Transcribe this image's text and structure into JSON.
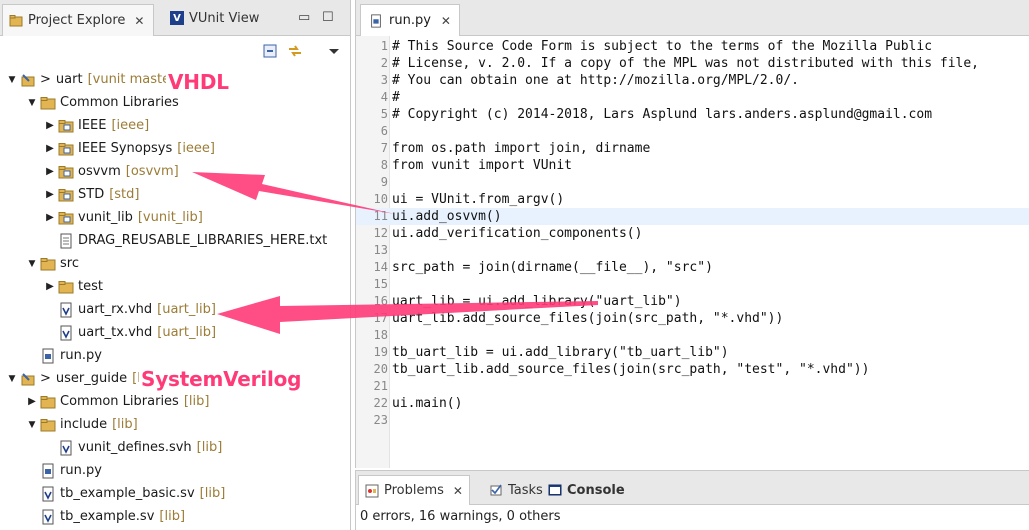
{
  "left_pane": {
    "tabs": [
      {
        "label": "Project Explore"
      },
      {
        "label": "VUnit View"
      }
    ],
    "tab_close": "✕",
    "minimize": "▭",
    "maximize": "☐",
    "tree": [
      {
        "label": "uart",
        "decoration": "[vunit maste",
        "prefix": ">"
      },
      {
        "label": "Common Libraries",
        "decoration": ""
      },
      {
        "label": "IEEE",
        "decoration": "[ieee]"
      },
      {
        "label": "IEEE Synopsys",
        "decoration": "[ieee]"
      },
      {
        "label": "osvvm",
        "decoration": "[osvvm]"
      },
      {
        "label": "STD",
        "decoration": "[std]"
      },
      {
        "label": "vunit_lib",
        "decoration": "[vunit_lib]"
      },
      {
        "label": "DRAG_REUSABLE_LIBRARIES_HERE.txt",
        "decoration": ""
      },
      {
        "label": "src",
        "decoration": ""
      },
      {
        "label": "test",
        "decoration": ""
      },
      {
        "label": "uart_rx.vhd",
        "decoration": "[uart_lib]"
      },
      {
        "label": "uart_tx.vhd",
        "decoration": "[uart_lib]"
      },
      {
        "label": "run.py",
        "decoration": ""
      },
      {
        "label": "user_guide",
        "decoration": "[l",
        "prefix": ">"
      },
      {
        "label": "Common Libraries",
        "decoration": "[lib]"
      },
      {
        "label": "include",
        "decoration": "[lib]"
      },
      {
        "label": "vunit_defines.svh",
        "decoration": "[lib]"
      },
      {
        "label": "run.py",
        "decoration": ""
      },
      {
        "label": "tb_example_basic.sv",
        "decoration": "[lib]"
      },
      {
        "label": "tb_example.sv",
        "decoration": "[lib]"
      }
    ]
  },
  "annotations": {
    "vhdl": "VHDL",
    "systemverilog": "SystemVerilog",
    "color": "#ff3a78"
  },
  "editor": {
    "tab_label": "run.py",
    "tab_close": "✕",
    "lines": [
      {
        "n": "1",
        "text": "# This Source Code Form is subject to the terms of the Mozilla Public"
      },
      {
        "n": "2",
        "text": "# License, v. 2.0. If a copy of the MPL was not distributed with this file,"
      },
      {
        "n": "3",
        "text": "# You can obtain one at http://mozilla.org/MPL/2.0/."
      },
      {
        "n": "4",
        "text": "#"
      },
      {
        "n": "5",
        "text": "# Copyright (c) 2014-2018, Lars Asplund lars.anders.asplund@gmail.com"
      },
      {
        "n": "6",
        "text": ""
      },
      {
        "n": "7",
        "text": "from os.path import join, dirname"
      },
      {
        "n": "8",
        "text": "from vunit import VUnit"
      },
      {
        "n": "9",
        "text": ""
      },
      {
        "n": "10",
        "text": "ui = VUnit.from_argv()"
      },
      {
        "n": "11",
        "text": "ui.add_osvvm()"
      },
      {
        "n": "12",
        "text": "ui.add_verification_components()"
      },
      {
        "n": "13",
        "text": ""
      },
      {
        "n": "14",
        "text": "src_path = join(dirname(__file__), \"src\")"
      },
      {
        "n": "15",
        "text": ""
      },
      {
        "n": "16",
        "text": "uart_lib = ui.add_library(\"uart_lib\")"
      },
      {
        "n": "17",
        "text": "uart_lib.add_source_files(join(src_path, \"*.vhd\"))"
      },
      {
        "n": "18",
        "text": ""
      },
      {
        "n": "19",
        "text": "tb_uart_lib = ui.add_library(\"tb_uart_lib\")"
      },
      {
        "n": "20",
        "text": "tb_uart_lib.add_source_files(join(src_path, \"test\", \"*.vhd\"))"
      },
      {
        "n": "21",
        "text": ""
      },
      {
        "n": "22",
        "text": "ui.main()"
      },
      {
        "n": "23",
        "text": ""
      }
    ]
  },
  "bottom_panel": {
    "tabs": [
      {
        "label": "Problems"
      },
      {
        "label": "Tasks"
      },
      {
        "label": "Console"
      }
    ],
    "tab_close": "✕",
    "status": "0 errors, 16 warnings, 0 others"
  }
}
